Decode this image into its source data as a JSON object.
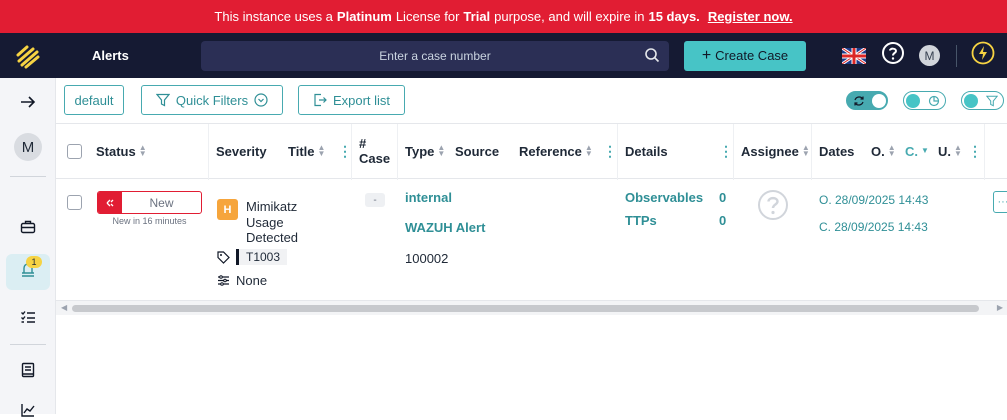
{
  "banner": {
    "part1": "This instance uses a",
    "license": "Platinum",
    "part2": "License for",
    "purpose": "Trial",
    "part3": "purpose, and will expire in",
    "days": "15 days.",
    "register": "Register now."
  },
  "topbar": {
    "title": "Alerts",
    "search_placeholder": "Enter a case number",
    "create_label": "Create Case",
    "avatar": "M"
  },
  "sidebar": {
    "avatar": "M",
    "alerts_badge": "1"
  },
  "toolbar": {
    "default_label": "default",
    "quick_filters_label": "Quick Filters",
    "export_label": "Export list"
  },
  "columns": {
    "status": "Status",
    "severity": "Severity",
    "title": "Title",
    "case_no_hash": "#",
    "case_no": "Case",
    "type": "Type",
    "source": "Source",
    "reference": "Reference",
    "details": "Details",
    "assignee": "Assignee",
    "dates": "Dates",
    "o": "O.",
    "c": "C.",
    "u": "U."
  },
  "rows": [
    {
      "status": "New",
      "status_sub": "New in 16 minutes",
      "severity": "H",
      "title_line1": "Mimikatz",
      "title_line2": "Usage",
      "title_line3": "Detected",
      "tag": "T1003",
      "tlp": "None",
      "case_number": "-",
      "type": "internal",
      "source": "WAZUH Alert",
      "reference": "100002",
      "observables_label": "Observables",
      "observables_count": "0",
      "ttps_label": "TTPs",
      "ttps_count": "0",
      "date_o": "O. 28/09/2025 14:43",
      "date_c": "C. 28/09/2025 14:43"
    }
  ],
  "colors": {
    "banner": "#e11d33",
    "topbar": "#151a33",
    "accent": "#47c4c6",
    "severity_high": "#f6a53c"
  }
}
